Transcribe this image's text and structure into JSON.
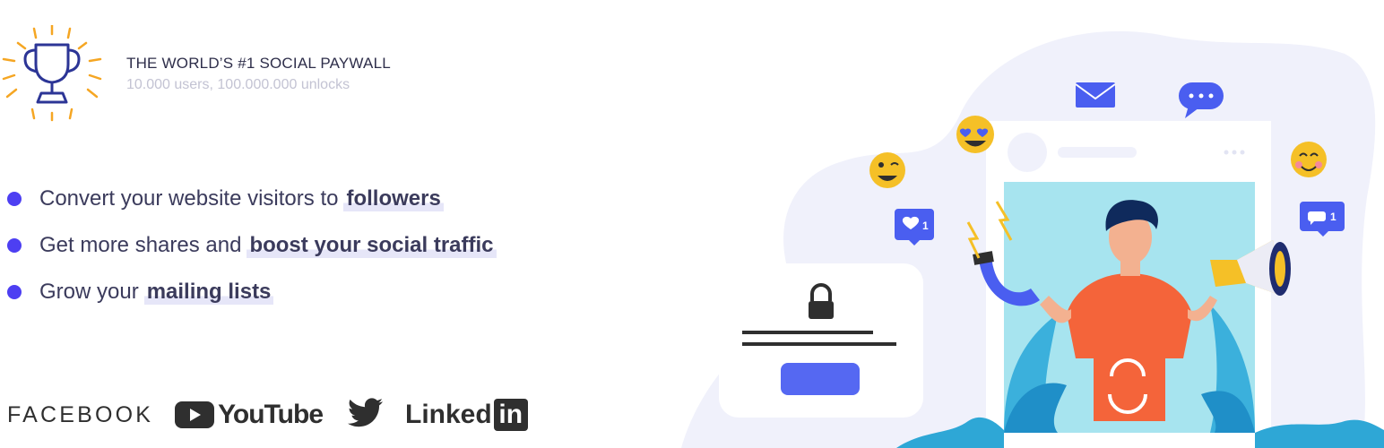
{
  "badge": {
    "icon": "trophy-icon",
    "accent": "#f5a623",
    "stroke": "#2c3596"
  },
  "tagline": {
    "title": "THE WORLD’S #1 SOCIAL PAYWALL",
    "subtitle": "10.000 users, 100.000.000 unlocks"
  },
  "features": [
    {
      "text": "Convert your website visitors to",
      "highlight": "followers"
    },
    {
      "text": "Get more shares and",
      "highlight": "boost your social traffic"
    },
    {
      "text": "Grow your",
      "highlight": "mailing lists"
    }
  ],
  "platforms": {
    "facebook": "FACEBOOK",
    "youtube": "YouTube",
    "twitter": "twitter-bird-icon",
    "linkedin_text": "Linked",
    "linkedin_box": "in"
  },
  "illustration": {
    "like_count": "1",
    "comment_count": "1",
    "colors": {
      "blob": "#f0f1fb",
      "primary": "#5568f2",
      "badge": "#4a5ef0",
      "lock": "#2f2f2f"
    }
  }
}
